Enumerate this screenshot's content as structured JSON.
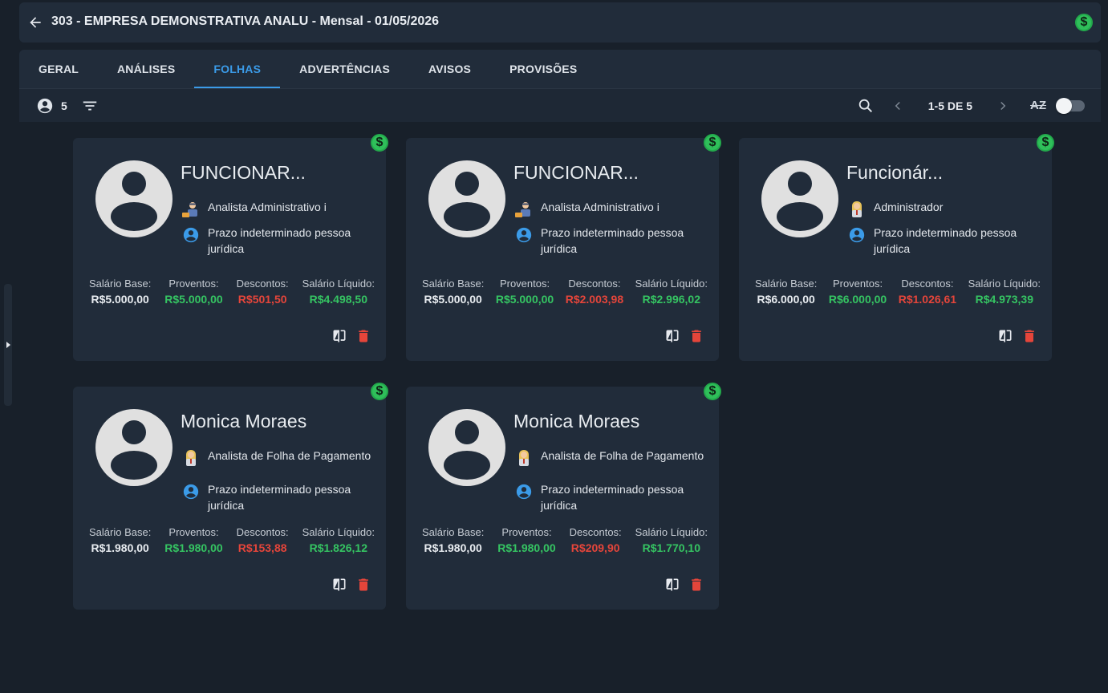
{
  "header": {
    "title": "303 - EMPRESA DEMONSTRATIVA ANALU - Mensal - 01/05/2026",
    "status_icon": "dollar-icon"
  },
  "tabs": [
    {
      "label": "GERAL",
      "active": false
    },
    {
      "label": "ANÁLISES",
      "active": false
    },
    {
      "label": "FOLHAS",
      "active": true
    },
    {
      "label": "ADVERTÊNCIAS",
      "active": false
    },
    {
      "label": "AVISOS",
      "active": false
    },
    {
      "label": "PROVISÕES",
      "active": false
    }
  ],
  "toolbar": {
    "employee_count": "5",
    "pagination": "1-5 DE 5",
    "sort_label": "AZ",
    "toggle_on": false
  },
  "colors": {
    "accent": "#3b9be8",
    "positive": "#35c462",
    "negative": "#e5453a",
    "badge": "#2fbf5a"
  },
  "stat_labels": {
    "base": "Salário Base:",
    "proventos": "Proventos:",
    "descontos": "Descontos:",
    "liquido": "Salário Líquido:"
  },
  "cards": [
    {
      "name": "FUNCIONAR...",
      "role": "Analista Administrativo i",
      "contract": "Prazo indeterminado pessoa jurídica",
      "salario_base": "R$5.000,00",
      "proventos": "R$5.000,00",
      "descontos": "R$501,50",
      "liquido": "R$4.498,50"
    },
    {
      "name": "FUNCIONAR...",
      "role": "Analista Administrativo i",
      "contract": "Prazo indeterminado pessoa jurídica",
      "salario_base": "R$5.000,00",
      "proventos": "R$5.000,00",
      "descontos": "R$2.003,98",
      "liquido": "R$2.996,02"
    },
    {
      "name": "Funcionár...",
      "role": "Administrador",
      "contract": "Prazo indeterminado pessoa jurídica",
      "salario_base": "R$6.000,00",
      "proventos": "R$6.000,00",
      "descontos": "R$1.026,61",
      "liquido": "R$4.973,39"
    },
    {
      "name": "Monica Moraes",
      "role": "Analista de Folha de Pagamento",
      "contract": "Prazo indeterminado pessoa jurídica",
      "salario_base": "R$1.980,00",
      "proventos": "R$1.980,00",
      "descontos": "R$153,88",
      "liquido": "R$1.826,12"
    },
    {
      "name": "Monica Moraes",
      "role": "Analista de Folha de Pagamento",
      "contract": "Prazo indeterminado pessoa jurídica",
      "salario_base": "R$1.980,00",
      "proventos": "R$1.980,00",
      "descontos": "R$209,90",
      "liquido": "R$1.770,10"
    }
  ]
}
